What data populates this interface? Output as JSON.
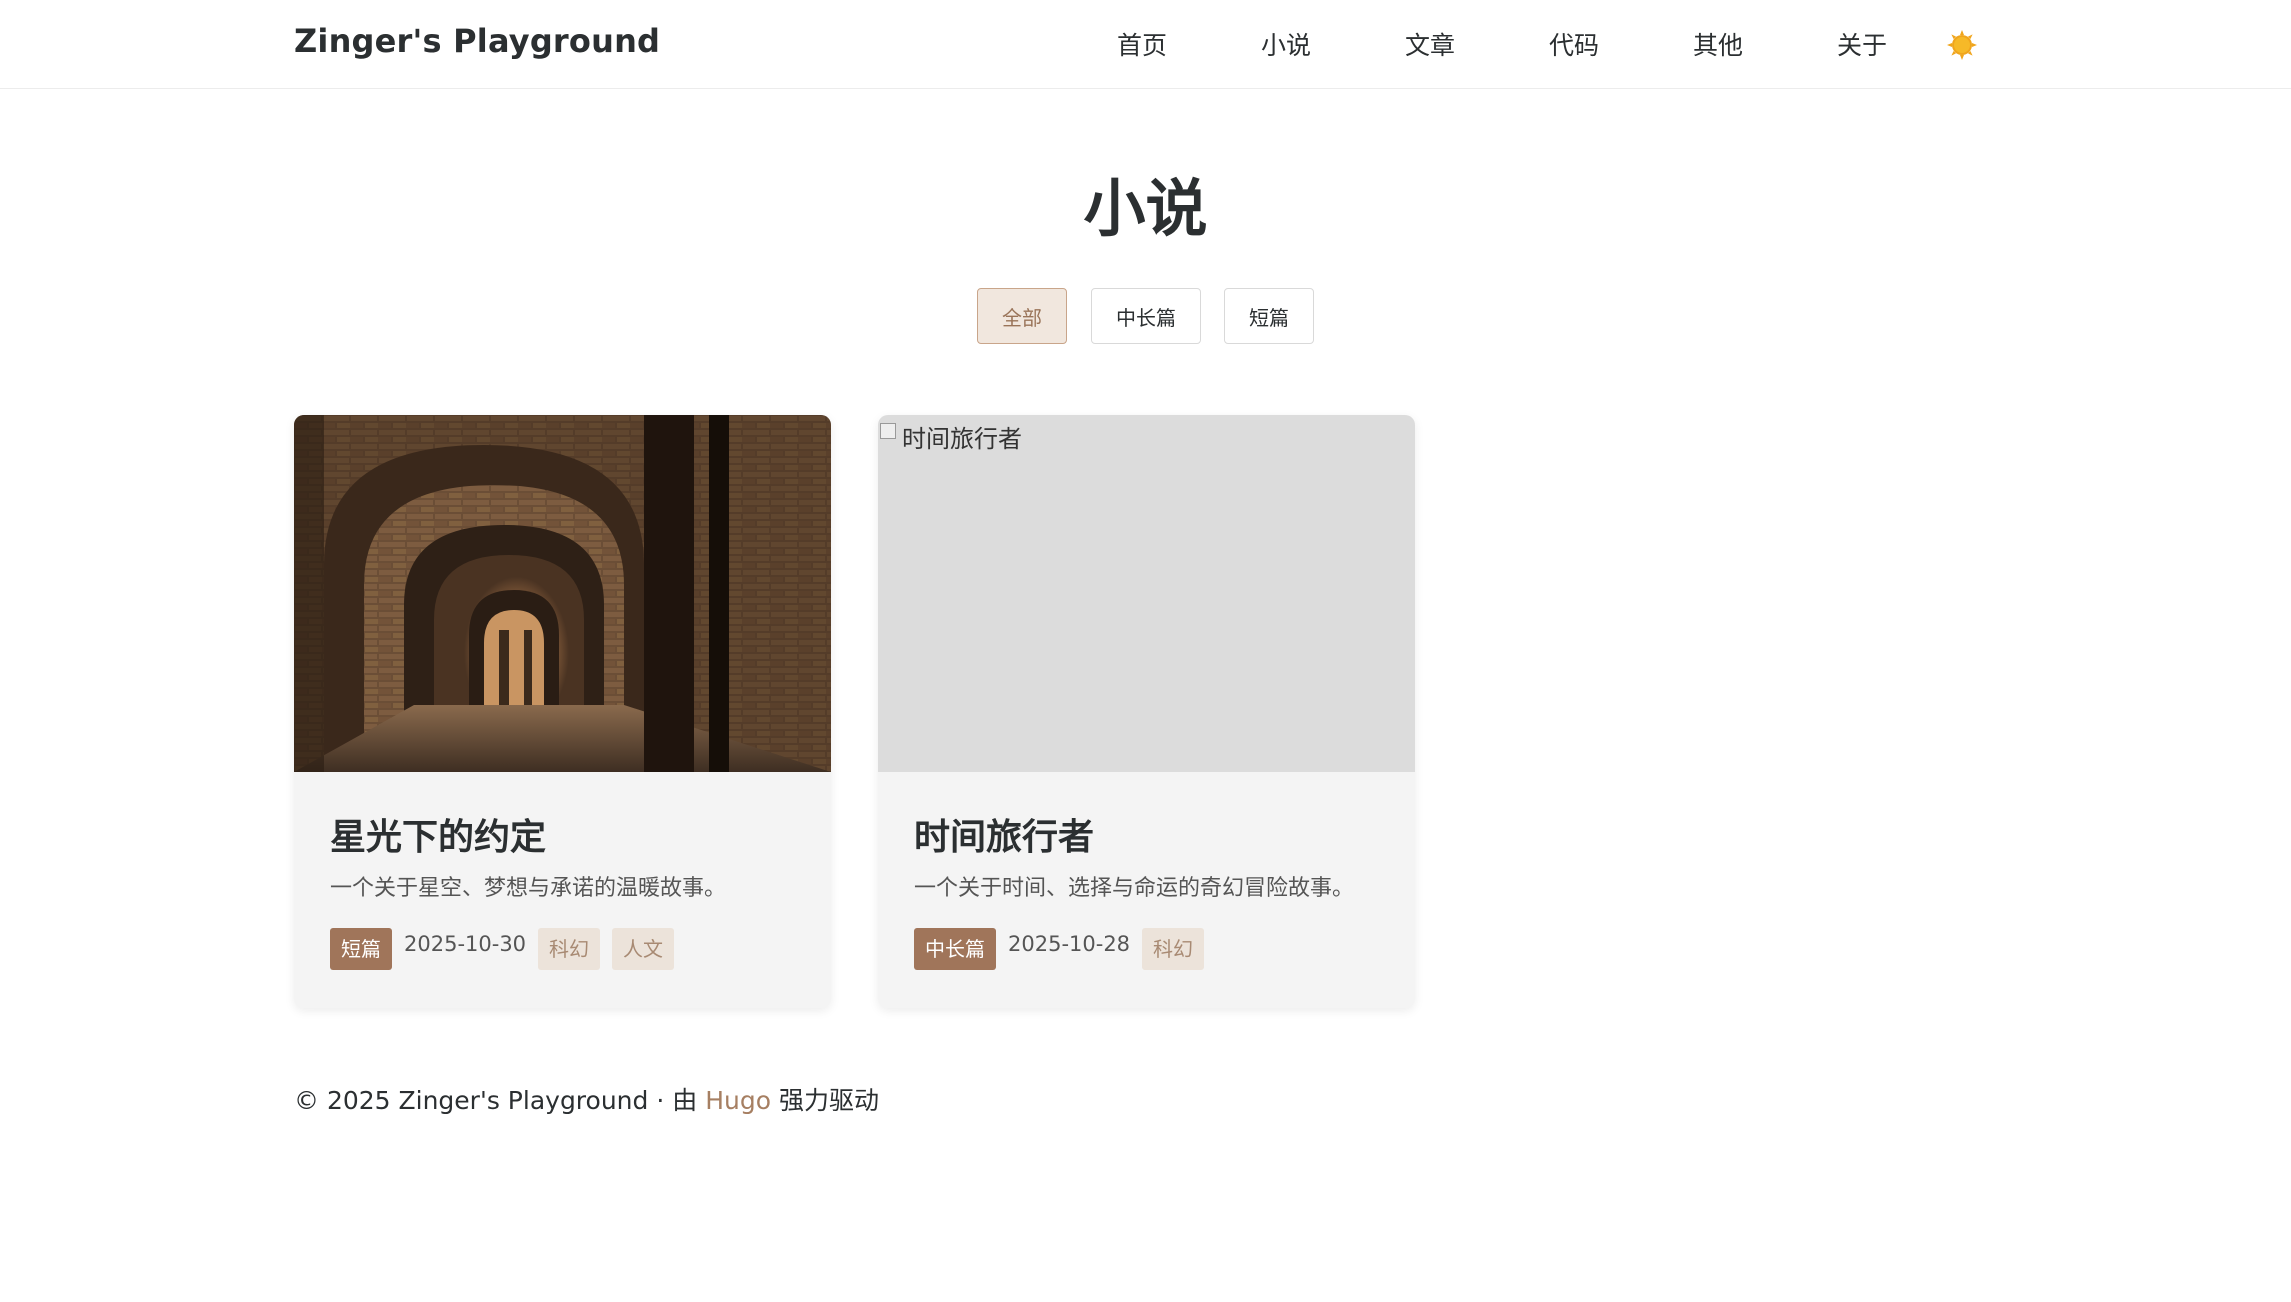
{
  "site": {
    "brand": "Zinger's Playground"
  },
  "nav": {
    "items": [
      "首页",
      "小说",
      "文章",
      "代码",
      "其他",
      "关于"
    ]
  },
  "theme_toggle_icon": "sun-icon",
  "page": {
    "title": "小说"
  },
  "filters": {
    "items": [
      "全部",
      "中长篇",
      "短篇"
    ],
    "active": "全部"
  },
  "cards": [
    {
      "title": "星光下的约定",
      "description": "一个关于星空、梦想与承诺的温暖故事。",
      "type": "短篇",
      "date": "2025-10-30",
      "tags": [
        "科幻",
        "人文"
      ],
      "image": "brick-arches-image"
    },
    {
      "title": "时间旅行者",
      "description": "一个关于时间、选择与命运的奇幻冒险故事。",
      "type": "中长篇",
      "date": "2025-10-28",
      "tags": [
        "科幻"
      ],
      "image_alt": "时间旅行者"
    }
  ],
  "footer": {
    "prefix": "© 2025 Zinger's Playground · 由 ",
    "link": "Hugo",
    "suffix": " 强力驱动"
  },
  "colors": {
    "accent": "#a0755a",
    "tag_bg": "#ece3da",
    "active_filter_bg": "#f1e7de"
  }
}
